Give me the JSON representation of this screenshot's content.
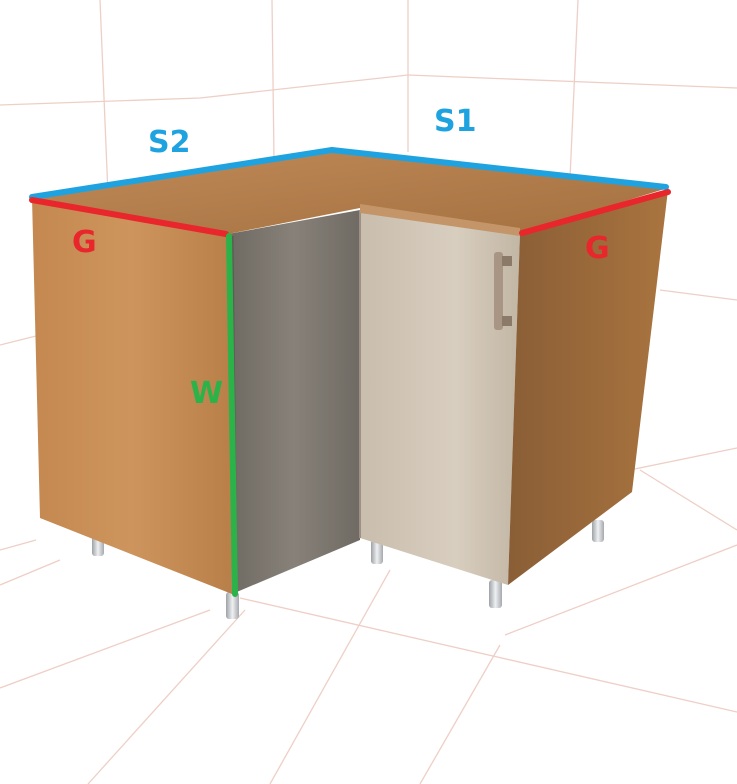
{
  "labels": {
    "s2": "S2",
    "s1": "S1",
    "g_left": "G",
    "g_right": "G",
    "w": "W"
  },
  "colors": {
    "s_edge": "#1fa3e0",
    "g_edge": "#e8262b",
    "w_edge": "#2bb34a",
    "wall_grid": "#eecfc6",
    "floor_grid": "#f0d2c8",
    "worktop": "#b27c4a",
    "side_panel": "#c78d55",
    "inner_panel": "#7d776f",
    "door": "#cfc3b2",
    "leg": "#d8dadc"
  },
  "icons": {
    "door_handle": "door-handle-icon"
  }
}
